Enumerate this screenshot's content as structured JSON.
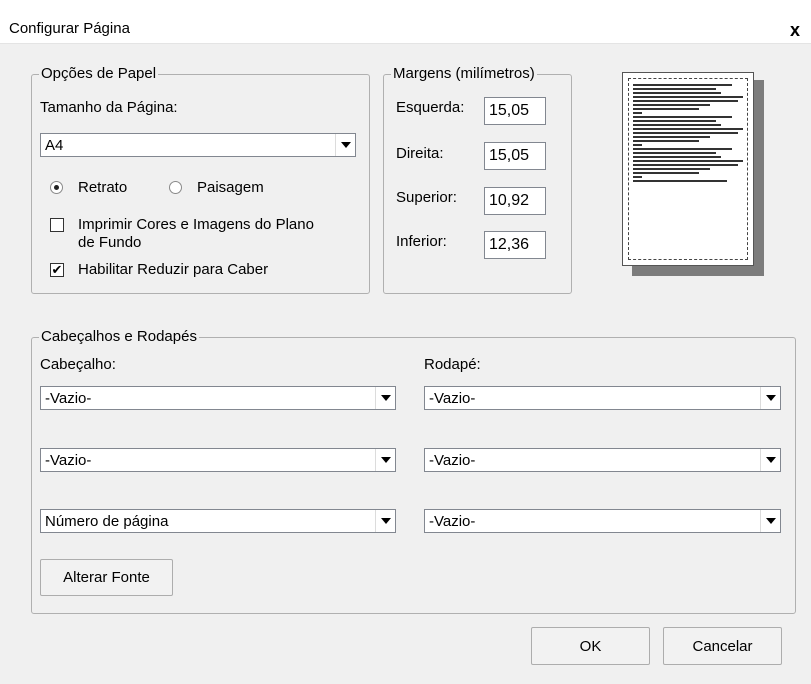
{
  "window": {
    "title": "Configurar Página",
    "close_glyph": "x"
  },
  "paper": {
    "legend": "Opções de Papel",
    "size_label": "Tamanho da Página:",
    "size_value": "A4",
    "portrait_label": "Retrato",
    "landscape_label": "Paisagem",
    "selected_orientation": "portrait",
    "print_bg_label_line1": "Imprimir Cores e Imagens do Plano",
    "print_bg_label_line2": "de Fundo",
    "print_bg_checked": false,
    "shrink_label": "Habilitar Reduzir para Caber",
    "shrink_checked": true,
    "check_glyph": "✔"
  },
  "margins": {
    "legend": "Margens (milímetros)",
    "left_label": "Esquerda:",
    "left_value": "15,05",
    "right_label": "Direita:",
    "right_value": "15,05",
    "top_label": "Superior:",
    "top_value": "10,92",
    "bottom_label": "Inferior:",
    "bottom_value": "12,36"
  },
  "headers_footers": {
    "legend": "Cabeçalhos e Rodapés",
    "header_label": "Cabeçalho:",
    "footer_label": "Rodapé:",
    "header_values": [
      "-Vazio-",
      "-Vazio-",
      "Número de página"
    ],
    "footer_values": [
      "-Vazio-",
      "-Vazio-",
      "-Vazio-"
    ],
    "change_font_label": "Alterar Fonte"
  },
  "buttons": {
    "ok_label": "OK",
    "cancel_label": "Cancelar"
  }
}
